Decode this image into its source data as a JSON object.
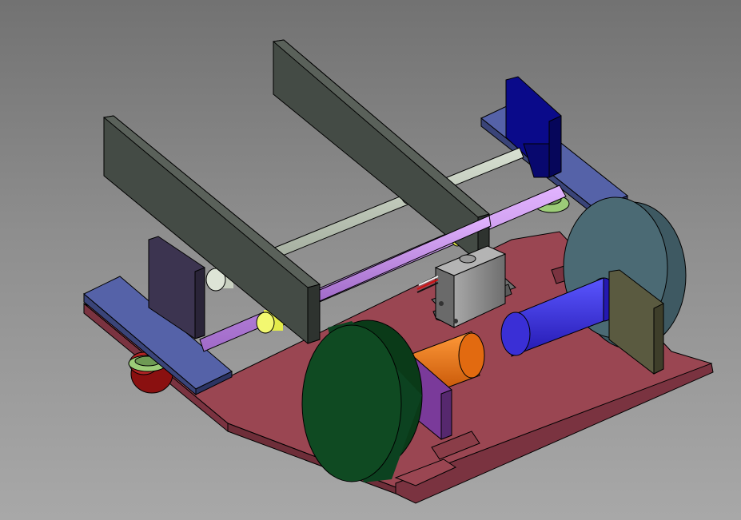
{
  "scene": {
    "colors": {
      "background_top": "#727272",
      "background_bottom": "#a8a8a8",
      "base_plate": "#9a4652",
      "wall_plate": "#444b45",
      "side_rail": "#5562a8",
      "front_wheel": "#0f4a22",
      "rear_wheel": "#4b6a74",
      "rod_grey": "#b8c2b0",
      "rod_purple": "#c58ae6",
      "motor_orange": "#e26a10",
      "motor_blue": "#3a2fd6",
      "motor_mount_purple": "#7a3a9a",
      "motor_mount_olive": "#5a5a40",
      "bushing_yellow": "#e4ec4a",
      "servo_grey": "#8a8a8a",
      "bracket_blue": "#0a0a8a",
      "bracket_violet": "#3c3450",
      "caster_red": "#8a1010",
      "caster_green": "#9ccc78"
    }
  }
}
